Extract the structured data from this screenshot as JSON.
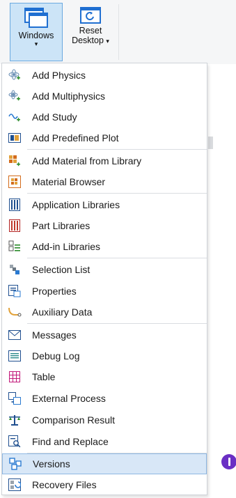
{
  "ribbon": {
    "windows_label": "Windows",
    "windows_arrow": "▾",
    "reset_label_line1": "Reset",
    "reset_label_line2": "Desktop",
    "reset_arrow": "▾"
  },
  "menu": {
    "items": [
      {
        "label": "Add Physics",
        "icon": "add-physics-icon"
      },
      {
        "label": "Add Multiphysics",
        "icon": "add-multiphysics-icon"
      },
      {
        "label": "Add Study",
        "icon": "add-study-icon"
      },
      {
        "label": "Add Predefined Plot",
        "icon": "add-plot-icon"
      },
      {
        "label": "Add Material from Library",
        "icon": "add-material-icon"
      },
      {
        "label": "Material Browser",
        "icon": "material-browser-icon"
      },
      {
        "label": "Application Libraries",
        "icon": "application-libraries-icon"
      },
      {
        "label": "Part Libraries",
        "icon": "part-libraries-icon"
      },
      {
        "label": "Add-in Libraries",
        "icon": "addin-libraries-icon"
      },
      {
        "label": "Selection List",
        "icon": "selection-list-icon"
      },
      {
        "label": "Properties",
        "icon": "properties-icon"
      },
      {
        "label": "Auxiliary Data",
        "icon": "auxiliary-data-icon"
      },
      {
        "label": "Messages",
        "icon": "messages-icon"
      },
      {
        "label": "Debug Log",
        "icon": "debug-log-icon"
      },
      {
        "label": "Table",
        "icon": "table-icon"
      },
      {
        "label": "External Process",
        "icon": "external-process-icon"
      },
      {
        "label": "Comparison Result",
        "icon": "comparison-result-icon"
      },
      {
        "label": "Find and Replace",
        "icon": "find-replace-icon"
      },
      {
        "label": "Versions",
        "icon": "versions-icon"
      },
      {
        "label": "Recovery Files",
        "icon": "recovery-files-icon"
      }
    ]
  },
  "colors": {
    "accent": "#1f6fd1",
    "hover_bg": "#d8e7f7",
    "badge": "#6a2fc4"
  }
}
